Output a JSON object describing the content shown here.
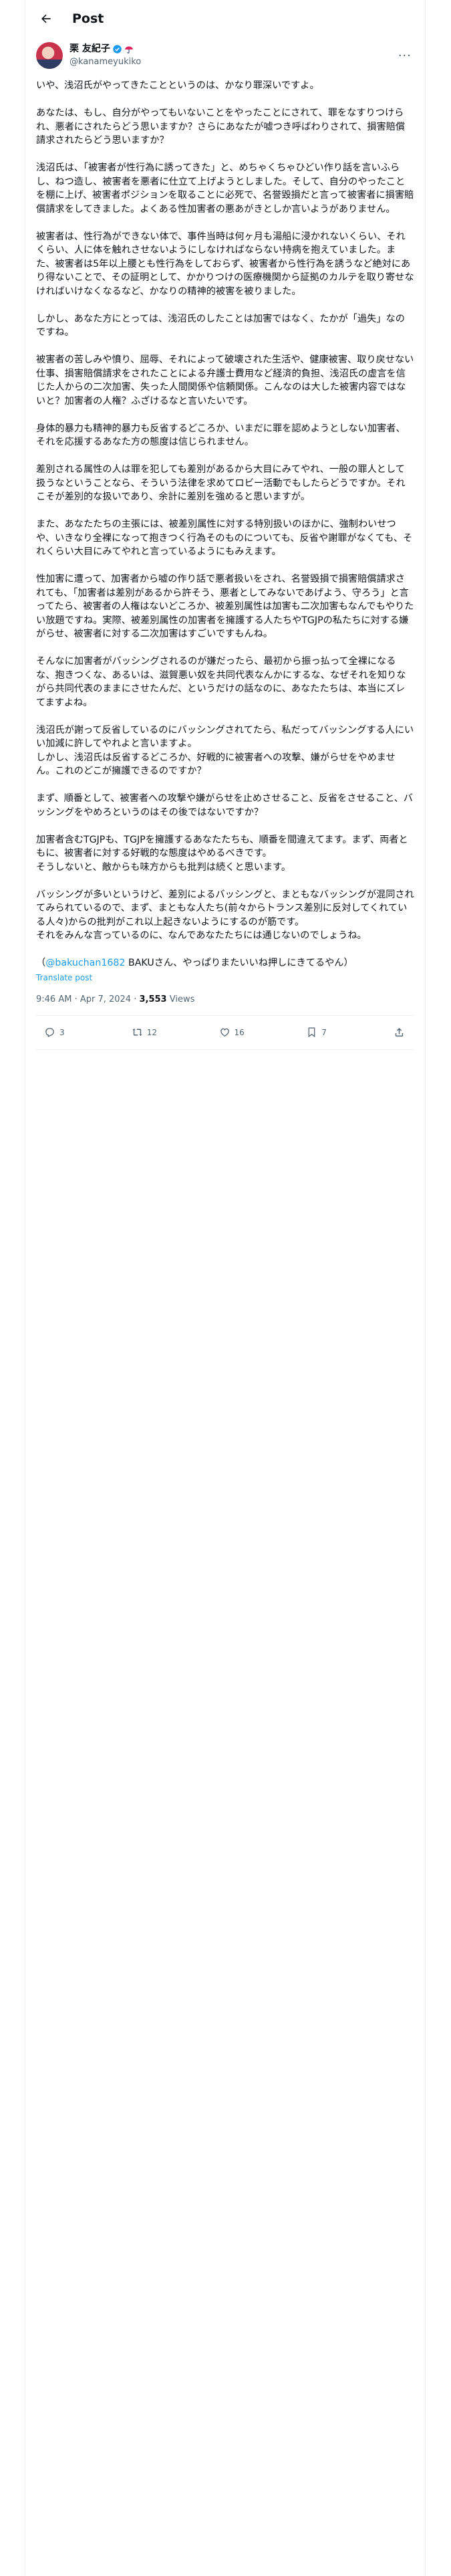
{
  "header": {
    "title": "Post"
  },
  "author": {
    "name": "栗 友紀子",
    "handle": "@kanameyukiko",
    "badge_color": "#1d9bf0"
  },
  "post": {
    "text": "いや、浅沼氏がやってきたことというのは、かなり罪深いですよ。\n\nあなたは、もし、自分がやってもいないことをやったことにされて、罪をなすりつけられ、悪者にされたらどう思いますか？さらにあなたが嘘つき呼ばわりされて、損害賠償請求されたらどう思いますか？\n\n浅沼氏は、「被害者が性行為に誘ってきた」と、めちゃくちゃひどい作り話を言いふらし、ねつ造し、被害者を悪者に仕立て上げようとしました。そして、自分のやったことを棚に上げ、被害者ポジションを取ることに必死で、名誉毀損だと言って被害者に損害賠償請求をしてきました。よくある性加害者の悪あがきとしか言いようがありません。\n\n被害者は、性行為ができない体で、事件当時は何ヶ月も湯船に浸かれないくらい、それくらい、人に体を触れさせないようにしなければならない持病を抱えていました。また、被害者は5年以上腰とも性行為をしておらず、被害者から性行為を誘うなど絶対にあり得ないことで、その証明として、かかりつけの医療機関から証拠のカルテを取り寄せなければいけなくなるなど、かなりの精神的被害を被りました。\n\nしかし、あなた方にとっては、浅沼氏のしたことは加害ではなく、たかが「過失」なのですね。\n\n被害者の苦しみや憤り、屈辱、それによって破壊された生活や、健康被害、取り戻せない仕事、損害賠償請求をされたことによる弁護士費用など経済的負担、浅沼氏の虚言を信じた人からの二次加害、失った人間関係や信頼関係。こんなのは大した被害内容ではないと？加害者の人権？ふざけるなと言いたいです。\n\n身体的暴力も精神的暴力も反省するどころか、いまだに罪を認めようとしない加害者、それを応援するあなた方の態度は信じられません。\n\n差別される属性の人は罪を犯しても差別があるから大目にみてやれ、一般の罪人として扱うなということなら、そういう法律を求めてロビー活動でもしたらどうですか。それこそが差別的な扱いであり、余計に差別を強めると思いますが。\n\nまた、あなたたちの主張には、被差別属性に対する特別扱いのほかに、強制わいせつや、いきなり全裸になって抱きつく行為そのものについても、反省や謝罪がなくても、それくらい大目にみてやれと言っているようにもみえます。\n\n性加害に遭って、加害者から嘘の作り話で悪者扱いをされ、名誉毀損で損害賠償請求されても、「加害者は差別があるから許そう、悪者としてみないであげよう、守ろう」と言ってたら、被害者の人権はないどころか、被差別属性は加害も二次加害もなんでもやりたい放題ですね。実際、被差別属性の加害者を擁護する人たちやTGJPの私たちに対する嫌がらせ、被害者に対する二次加害はすごいですもんね。\n\nそんなに加害者がバッシングされるのが嫌だったら、最初から振っ払って全裸になるな、抱きつくな、あるいは、滋賀悪い奴を共同代表なんかにするな、なぜそれを知りながら共同代表のままにさせたんだ、というだけの話なのに、あなたたちは、本当にズレてますよね。\n\n浅沼氏が謝って反省しているのにバッシングされてたら、私だってバッシングする人にいい加減に許してやれよと言いますよ。\nしかし、浅沼氏は反省するどころか、好戦的に被害者への攻撃、嫌がらせをやめません。これのどこが擁護できるのですか？\n\nまず、順番として、被害者への攻撃や嫌がらせを止めさせること、反省をさせること、バッシングをやめろというのはその後ではないですか？\n\n加害者含むTGJPも、TGJPを擁護するあなたたちも、順番を間違えてます。まず、両者ともに、被害者に対する好戦的な態度はやめるべきです。\nそうしないと、敵からも味方からも批判は続くと思います。\n\nバッシングが多いというけど、差別によるバッシングと、まともなバッシングが混同されてみられているので、まず、まともな人たち(前々からトランス差別に反対してくれている人々)からの批判がこれ以上起きないようにするのが筋です。\nそれをみんな言っているのに、なんであなたたちには通じないのでしょうね。",
    "reply_to": "@bakuchan1682",
    "reply_tail": " BAKUさん、やっぱりまたいいね押しにきてるやん）",
    "reply_open": "（",
    "translate": "Translate post",
    "time": "9:46 AM · Apr 7, 2024 · ",
    "views_count": "3,553",
    "views_label": " Views"
  },
  "actions": {
    "replies": "3",
    "reposts": "12",
    "likes": "16",
    "bookmarks": "7"
  }
}
